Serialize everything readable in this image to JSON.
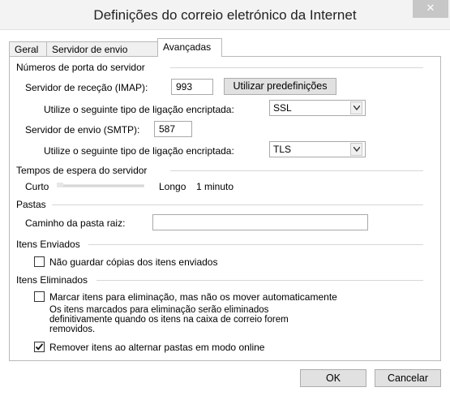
{
  "window": {
    "title": "Definições do correio eletrónico da Internet",
    "close_label": "✕"
  },
  "tabs": [
    {
      "label": "Geral",
      "active": false
    },
    {
      "label": "Servidor de envio",
      "active": false
    },
    {
      "label": "Avançadas",
      "active": true
    }
  ],
  "ports": {
    "group_label": "Números de porta do servidor",
    "incoming_label": "Servidor de receção (IMAP):",
    "incoming_value": "993",
    "defaults_button": "Utilizar predefinições",
    "incoming_encryption_label": "Utilize o seguinte tipo de ligação encriptada:",
    "incoming_encryption_value": "SSL",
    "outgoing_label": "Servidor de envio (SMTP):",
    "outgoing_value": "587",
    "outgoing_encryption_label": "Utilize o seguinte tipo de ligação encriptada:",
    "outgoing_encryption_value": "TLS"
  },
  "timeouts": {
    "group_label": "Tempos de espera do servidor",
    "short_label": "Curto",
    "long_label": "Longo",
    "value_label": "1 minuto",
    "slider_level": 0.0
  },
  "folders": {
    "group_label": "Pastas",
    "root_path_label": "Caminho da pasta raiz:",
    "root_path_value": ""
  },
  "sent_items": {
    "group_label": "Itens Enviados",
    "dont_save_label": "Não guardar cópias dos itens enviados",
    "dont_save_checked": false
  },
  "deleted_items": {
    "group_label": "Itens Eliminados",
    "mark_label": "Marcar itens para eliminação, mas não os mover automaticamente",
    "mark_checked": false,
    "info_line1": "Os itens marcados para eliminação serão eliminados",
    "info_line2": "definitivamente quando os itens na caixa de correio forem",
    "info_line3": "removidos.",
    "purge_label": "Remover itens ao alternar pastas em modo online",
    "purge_checked": true
  },
  "footer": {
    "ok_label": "OK",
    "cancel_label": "Cancelar"
  },
  "icons": {
    "close": "close-icon",
    "dropdown": "chevron-down-icon",
    "check": "checkmark-icon"
  }
}
